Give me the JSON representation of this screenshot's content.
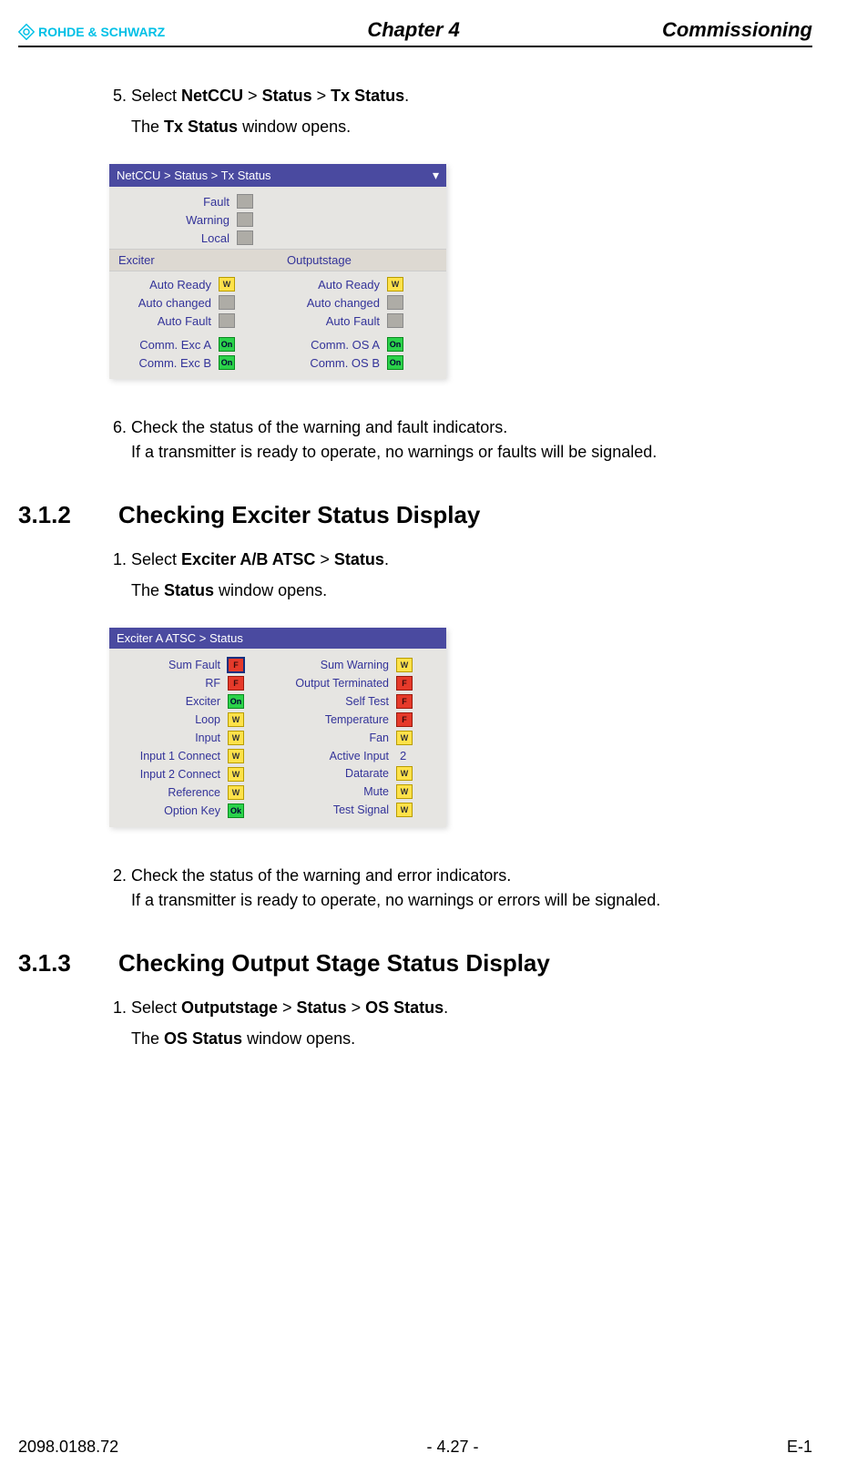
{
  "header": {
    "brand": "ROHDE & SCHWARZ",
    "chapter": "Chapter 4",
    "title": "Commissioning"
  },
  "step5": {
    "number": "5.",
    "text_prefix": "Select ",
    "path1": "NetCCU",
    "gt1": " > ",
    "path2": "Status",
    "gt2": " > ",
    "path3": "Tx Status",
    "period": ".",
    "follow_prefix": "The ",
    "follow_bold": "Tx Status",
    "follow_suffix": " window opens."
  },
  "panel1": {
    "title": "NetCCU  >  Status > Tx  Status",
    "top": [
      {
        "label": "Fault",
        "kind": "gray",
        "txt": ""
      },
      {
        "label": "Warning",
        "kind": "gray",
        "txt": ""
      },
      {
        "label": "Local",
        "kind": "gray",
        "txt": ""
      }
    ],
    "colheads": {
      "left": "Exciter",
      "right": "Outputstage"
    },
    "left": [
      {
        "label": "Auto Ready",
        "kind": "yellow",
        "txt": "W"
      },
      {
        "label": "Auto changed",
        "kind": "gray",
        "txt": ""
      },
      {
        "label": "Auto Fault",
        "kind": "gray",
        "txt": ""
      },
      {
        "label": "Comm. Exc A",
        "kind": "green",
        "txt": "On"
      },
      {
        "label": "Comm. Exc B",
        "kind": "green",
        "txt": "On"
      }
    ],
    "right": [
      {
        "label": "Auto Ready",
        "kind": "yellow",
        "txt": "W"
      },
      {
        "label": "Auto changed",
        "kind": "gray",
        "txt": ""
      },
      {
        "label": "Auto Fault",
        "kind": "gray",
        "txt": ""
      },
      {
        "label": "Comm. OS A",
        "kind": "green",
        "txt": "On"
      },
      {
        "label": "Comm. OS B",
        "kind": "green",
        "txt": "On"
      }
    ]
  },
  "step6": {
    "number": "6.",
    "line1": "Check the status of the warning and fault indicators.",
    "line2": "If a transmitter is ready to operate, no warnings or faults will be signaled."
  },
  "section312": {
    "num": "3.1.2",
    "title": "Checking Exciter Status Display"
  },
  "step312_1": {
    "number": "1.",
    "text_prefix": "Select ",
    "path1": "Exciter A/B  ATSC",
    "gt1": " > ",
    "path2": "Status",
    "period": ".",
    "follow_prefix": "The ",
    "follow_bold": "Status",
    "follow_suffix": " window opens."
  },
  "panel2": {
    "title": "Exciter A ATSC  >  Status",
    "left": [
      {
        "label": "Sum Fault",
        "kind": "redbox",
        "txt": "F"
      },
      {
        "label": "RF",
        "kind": "red",
        "txt": "F"
      },
      {
        "label": "Exciter",
        "kind": "green",
        "txt": "On"
      },
      {
        "label": "Loop",
        "kind": "yellow",
        "txt": "W"
      },
      {
        "label": "Input",
        "kind": "yellow",
        "txt": "W"
      },
      {
        "label": "Input 1 Connect",
        "kind": "yellow",
        "txt": "W"
      },
      {
        "label": "Input 2 Connect",
        "kind": "yellow",
        "txt": "W"
      },
      {
        "label": "Reference",
        "kind": "yellow",
        "txt": "W"
      },
      {
        "label": "Option Key",
        "kind": "green",
        "txt": "Ok"
      }
    ],
    "right": [
      {
        "label": "Sum Warning",
        "kind": "yellow",
        "txt": "W"
      },
      {
        "label": "Output Terminated",
        "kind": "red",
        "txt": "F"
      },
      {
        "label": "Self Test",
        "kind": "red",
        "txt": "F"
      },
      {
        "label": "Temperature",
        "kind": "red",
        "txt": "F"
      },
      {
        "label": "Fan",
        "kind": "yellow",
        "txt": "W"
      },
      {
        "label": "Active Input",
        "kind": "text",
        "txt": "2"
      },
      {
        "label": "Datarate",
        "kind": "yellow",
        "txt": "W"
      },
      {
        "label": "Mute",
        "kind": "yellow",
        "txt": "W"
      },
      {
        "label": "Test Signal",
        "kind": "yellow",
        "txt": "W"
      }
    ]
  },
  "step312_2": {
    "number": "2.",
    "line1": "Check the status of the warning and error indicators.",
    "line2": "If a transmitter is ready to operate, no warnings or errors will be signaled."
  },
  "section313": {
    "num": "3.1.3",
    "title": "Checking Output Stage Status Display"
  },
  "step313_1": {
    "number": "1.",
    "text_prefix": "Select ",
    "path1": "Outputstage",
    "gt1": " > ",
    "path2": "Status",
    "gt2": " > ",
    "path3": "OS Status",
    "period": ".",
    "follow_prefix": "The ",
    "follow_bold": "OS Status",
    "follow_suffix": " window opens."
  },
  "footer": {
    "left": "2098.0188.72",
    "center": "- 4.27 -",
    "right": "E-1"
  }
}
